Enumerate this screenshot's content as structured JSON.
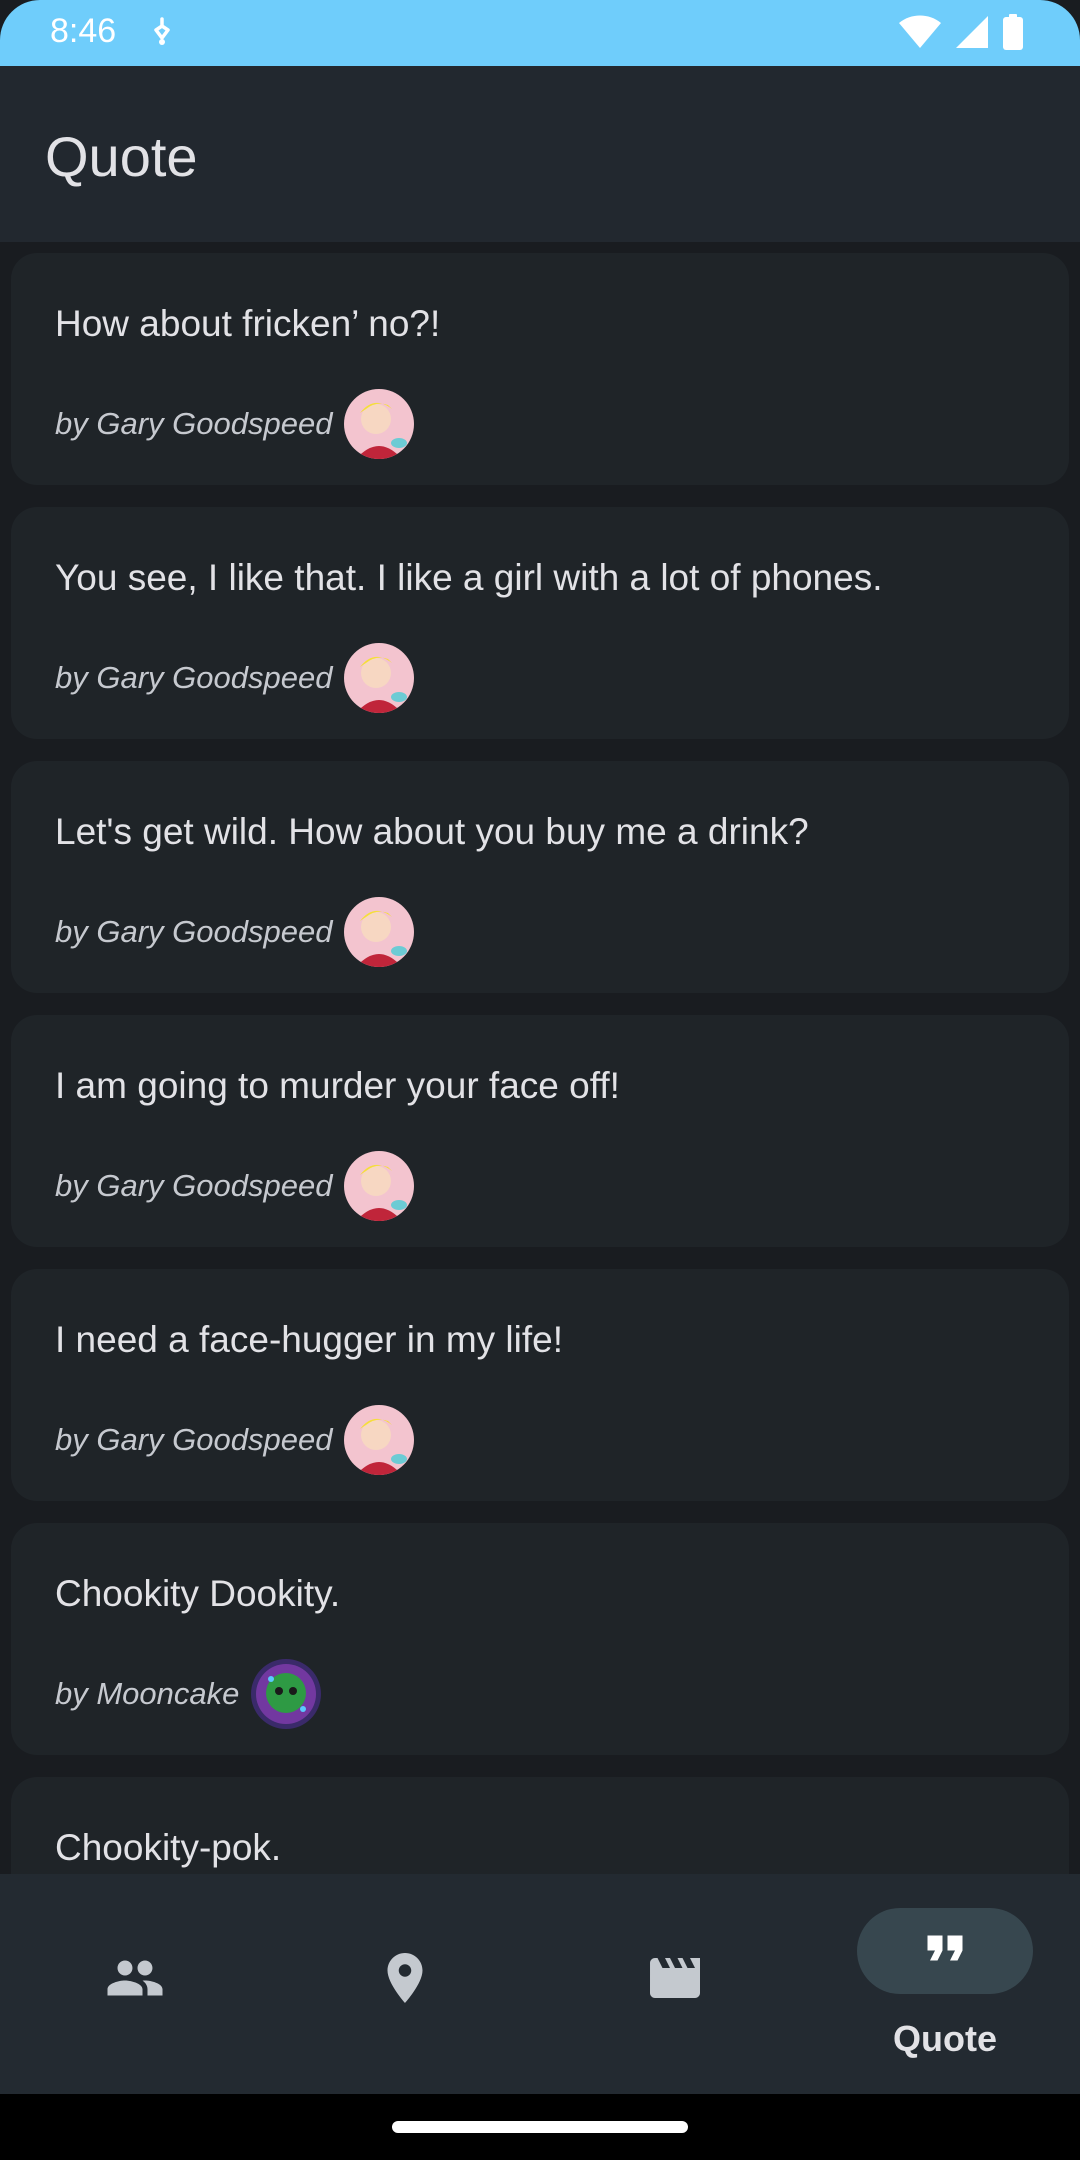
{
  "status_bar": {
    "time": "8:46"
  },
  "app_bar": {
    "title": "Quote"
  },
  "quotes": [
    {
      "text": "How about fricken’ no?!",
      "author": "by Gary Goodspeed",
      "avatar": "gary"
    },
    {
      "text": "You see, I like that. I like a girl with a lot of phones.",
      "author": "by Gary Goodspeed",
      "avatar": "gary"
    },
    {
      "text": "Let's get wild. How about you buy me a drink?",
      "author": "by Gary Goodspeed",
      "avatar": "gary"
    },
    {
      "text": "I am going to murder your face off!",
      "author": "by Gary Goodspeed",
      "avatar": "gary"
    },
    {
      "text": "I need a face-hugger in my life!",
      "author": "by Gary Goodspeed",
      "avatar": "gary"
    },
    {
      "text": "Chookity Dookity.",
      "author": "by Mooncake",
      "avatar": "mooncake"
    },
    {
      "text": "Chookity-pok.",
      "author": "",
      "avatar": ""
    }
  ],
  "bottom_nav": {
    "items": [
      {
        "icon": "people-icon",
        "label": ""
      },
      {
        "icon": "location-pin-icon",
        "label": ""
      },
      {
        "icon": "movie-icon",
        "label": ""
      },
      {
        "icon": "quote-icon",
        "label": "Quote",
        "selected": true
      }
    ]
  },
  "colors": {
    "status_bar": "#6fcdfb",
    "app_bar": "#22282f",
    "background": "#191c20",
    "card": "#1f2428",
    "nav_pill": "#37474f"
  }
}
